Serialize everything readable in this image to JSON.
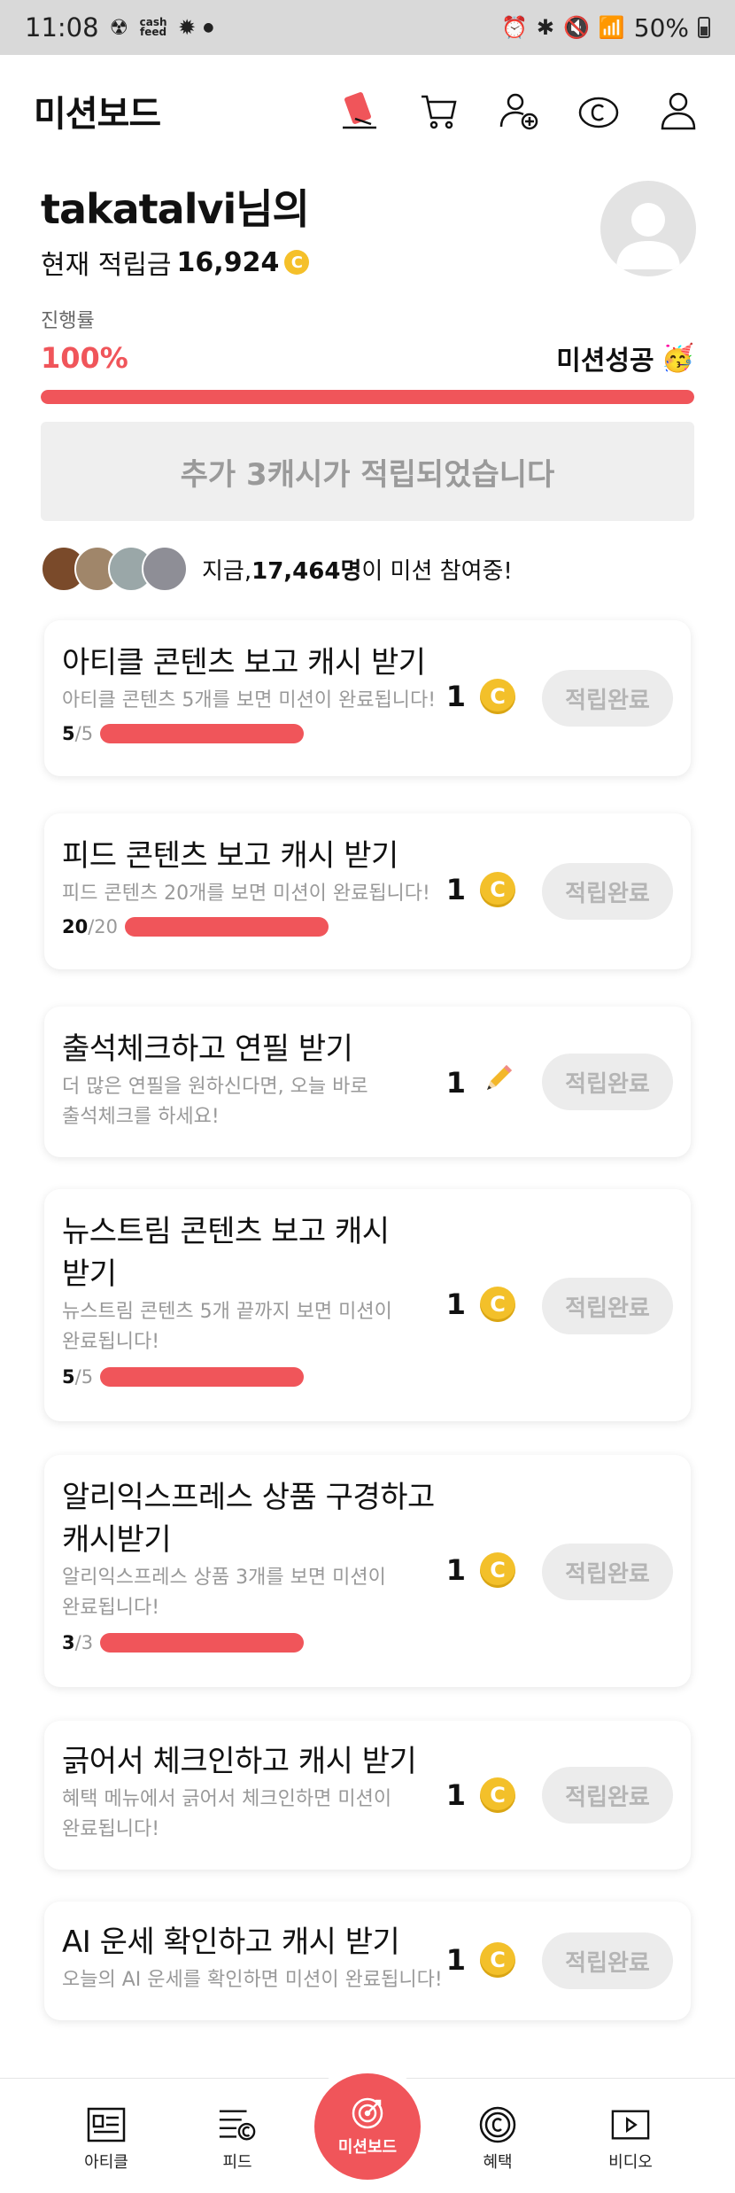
{
  "status_bar": {
    "time": "11:08",
    "battery": "50%",
    "cash_badge": "cash feed"
  },
  "header": {
    "title": "미션보드"
  },
  "profile": {
    "username": "takatalvi님의",
    "balance_label": "현재 적립금",
    "balance_value": "16,924",
    "coin_symbol": "C"
  },
  "progress": {
    "label": "진행률",
    "percent_text": "100%",
    "percent": 100,
    "status": "미션성공",
    "status_emoji": "🥳"
  },
  "notice": "추가 3캐시가 적립되었습니다",
  "participants": {
    "prefix": "지금, ",
    "count": "17,464명",
    "suffix": "이 미션 참여중!"
  },
  "missions": [
    {
      "title": "아티클 콘텐츠 보고 캐시 받기",
      "desc": "아티클 콘텐츠 5개를 보면 미션이 완료됩니다!",
      "done": "5",
      "total": "/5",
      "reward": "1",
      "reward_icon": "coin-icon",
      "button": "적립완료"
    },
    {
      "title": "피드 콘텐츠 보고 캐시 받기",
      "desc": "피드 콘텐츠 20개를 보면 미션이 완료됩니다!",
      "done": "20",
      "total": "/20",
      "reward": "1",
      "reward_icon": "coin-icon",
      "button": "적립완료"
    },
    {
      "title": "출석체크하고 연필 받기",
      "desc_lines": [
        "더 많은 연필을 원하신다면, 오늘 바로",
        "출석체크를 하세요!"
      ],
      "reward": "1",
      "reward_icon": "pencil-icon",
      "button": "적립완료"
    },
    {
      "title_lines": [
        "뉴스트림 콘텐츠 보고 캐시",
        "받기"
      ],
      "desc_lines": [
        "뉴스트림 콘텐츠 5개 끝까지 보면 미션이",
        "완료됩니다!"
      ],
      "done": "5",
      "total": "/5",
      "reward": "1",
      "reward_icon": "coin-icon",
      "button": "적립완료"
    },
    {
      "title_lines": [
        "알리익스프레스 상품 구경하고",
        "캐시받기"
      ],
      "desc_lines": [
        "알리익스프레스 상품 3개를 보면 미션이",
        "완료됩니다!"
      ],
      "done": "3",
      "total": "/3",
      "reward": "1",
      "reward_icon": "coin-icon",
      "button": "적립완료"
    },
    {
      "title": "긁어서 체크인하고 캐시 받기",
      "desc_lines": [
        "혜택 메뉴에서 긁어서 체크인하면 미션이",
        "완료됩니다!"
      ],
      "reward": "1",
      "reward_icon": "coin-icon",
      "button": "적립완료"
    },
    {
      "title": "AI 운세 확인하고 캐시 받기",
      "desc": "오늘의 AI 운세를 확인하면 미션이 완료됩니다!",
      "reward": "1",
      "reward_icon": "coin-icon",
      "button": "적립완료"
    }
  ],
  "bottom_nav": {
    "article": "아티클",
    "feed": "피드",
    "center": "미션보드",
    "benefit": "혜택",
    "video": "비디오"
  },
  "colors": {
    "accent": "#f0555a",
    "coin": "#f3c02a",
    "button_bg": "#ececec"
  }
}
